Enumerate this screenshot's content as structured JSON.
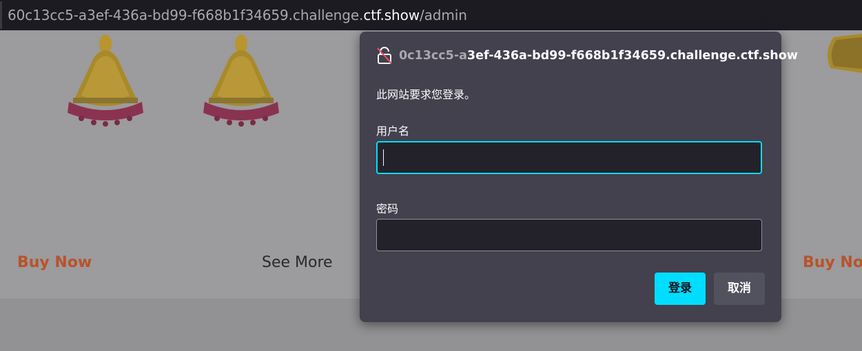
{
  "browser": {
    "url_prefix": "60c13cc5-a3ef-436a-bd99-f668b1f34659.challenge.",
    "url_host": "ctf.show",
    "url_path": "/admin"
  },
  "page": {
    "buy_now_left": "Buy Now",
    "see_more": "See More",
    "buy_now_right": "Buy No"
  },
  "dialog": {
    "host_fade": "0c13cc5-a",
    "host_rest": "3ef-436a-bd99-f668b1f34659.challenge.ctf.show",
    "message": "此网站要求您登录。",
    "username_label": "用户名",
    "username_value": "",
    "password_label": "密码",
    "password_value": "",
    "login_button": "登录",
    "cancel_button": "取消",
    "lock_icon": "insecure-lock-icon"
  },
  "colors": {
    "accent": "#00ddff",
    "dialog_bg": "#42414d",
    "buy_now": "#b8532a"
  }
}
